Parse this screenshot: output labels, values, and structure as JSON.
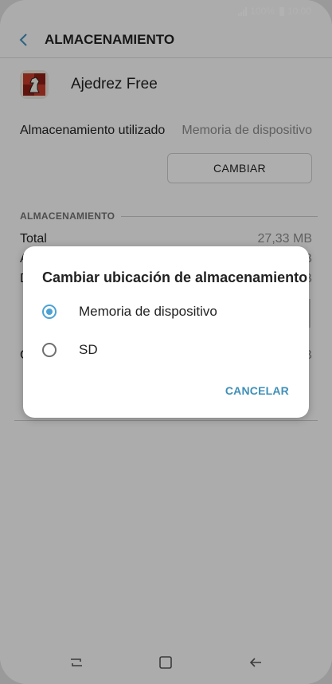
{
  "status_bar": {
    "battery": "100%",
    "time": "10:00"
  },
  "app_bar": {
    "title": "ALMACENAMIENTO",
    "back_icon": "chevron-left-icon"
  },
  "app_info": {
    "name": "Ajedrez Free",
    "icon": "chess-app-icon"
  },
  "storage_used": {
    "label": "Almacenamiento utilizado",
    "value": "Memoria de dispositivo"
  },
  "change_button": {
    "label": "CAMBIAR"
  },
  "section": {
    "header": "ALMACENAMIENTO"
  },
  "total": {
    "label": "Total",
    "value": "27,33 MB"
  },
  "obscured": {
    "row1_left": "A",
    "row1_right": "B",
    "row2_left": "D",
    "row2_right": "B",
    "row3_left": "C",
    "row3_right": "B"
  },
  "dialog": {
    "title": "Cambiar ubicación de almacenamiento",
    "options": [
      {
        "label": "Memoria de dispositivo",
        "selected": true
      },
      {
        "label": "SD",
        "selected": false
      }
    ],
    "cancel_label": "CANCELAR"
  },
  "navbar": {
    "recents_icon": "recents-icon",
    "home_icon": "home-icon",
    "back_icon": "back-arrow-icon"
  },
  "colors": {
    "accent": "#4ca2d4",
    "cancel": "#3f8fb8"
  }
}
